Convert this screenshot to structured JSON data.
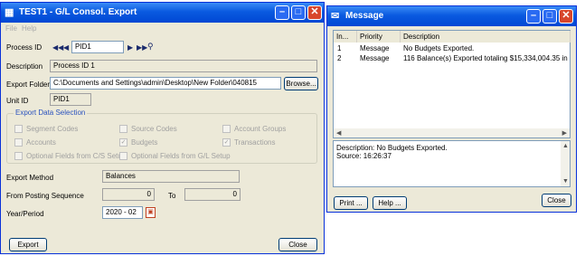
{
  "export_window": {
    "title": "TEST1 - G/L Consol. Export",
    "menu": [
      "File",
      "Help"
    ],
    "process_id_label": "Process ID",
    "process_id_value": "PID1",
    "description_label": "Description",
    "description_value": "Process ID 1",
    "export_folder_label": "Export Folder",
    "export_folder_value": "C:\\Documents and Settings\\admin\\Desktop\\New Folder\\040815",
    "browse_label": "Browse...",
    "unit_id_label": "Unit ID",
    "unit_id_value": "PID1",
    "selection_title": "Export Data Selection",
    "checkboxes": {
      "segment_codes": "Segment Codes",
      "source_codes": "Source Codes",
      "account_groups": "Account Groups",
      "accounts": "Accounts",
      "budgets": "Budgets",
      "transactions": "Transactions",
      "optional_cs": "Optional Fields from C/S Setup",
      "optional_gl": "Optional Fields from G/L Setup"
    },
    "checked": {
      "budgets": true,
      "transactions": true
    },
    "export_method_label": "Export Method",
    "export_method_value": "Balances",
    "from_posting_label": "From Posting Sequence",
    "from_value": "0",
    "to_label": "To",
    "to_value": "0",
    "year_period_label": "Year/Period",
    "year_period_value": "2020 - 02",
    "export_button": "Export",
    "close_button": "Close"
  },
  "message_window": {
    "title": "Message",
    "columns": [
      "In...",
      "Priority",
      "Description"
    ],
    "rows": [
      [
        "1",
        "Message",
        "No Budgets Exported."
      ],
      [
        "2",
        "Message",
        "116 Balance(s) Exported totaling $15,334,004.35 in Debits ..."
      ]
    ],
    "detail_description": "Description: No Budgets Exported.",
    "detail_source": "Source:  16:26:37",
    "print_button": "Print ...",
    "help_button": "Help ...",
    "close_button": "Close"
  },
  "colors": {
    "titlebar": "#0a5ae0",
    "window_bg": "#ece9d8",
    "group_title": "#2a52be",
    "close_red": "#d8462c"
  }
}
